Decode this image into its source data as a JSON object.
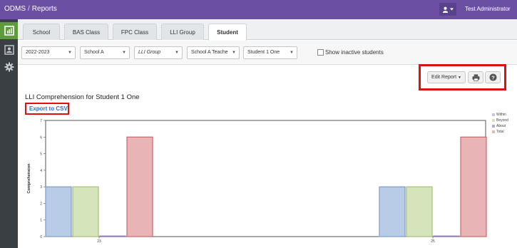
{
  "topbar": {
    "app": "ODMS",
    "separator": "/",
    "section": "Reports",
    "user_name": "Test Administrator",
    "user_icon": "user-icon"
  },
  "sidebar": {
    "items": [
      {
        "name": "reports-icon",
        "active": true
      },
      {
        "name": "student-card-icon",
        "active": false
      },
      {
        "name": "gear-icon",
        "active": false
      }
    ]
  },
  "tabs": [
    {
      "label": "School"
    },
    {
      "label": "BAS Class"
    },
    {
      "label": "FPC Class"
    },
    {
      "label": "LLI Group"
    },
    {
      "label": "Student",
      "active": true
    }
  ],
  "filters": {
    "year": "2022-2023",
    "school": "School A",
    "group": "LLI Group",
    "teacher": "School A Teache",
    "student": "Student 1 One",
    "show_inactive_label": "Show inactive students",
    "show_inactive_checked": false
  },
  "toolbar": {
    "edit_report": "Edit Report",
    "print_icon": "print-icon",
    "help_icon": "help-icon"
  },
  "report": {
    "title": "LLI Comprehension for Student 1 One",
    "export_label": "Export to CSV"
  },
  "chart_data": {
    "type": "bar",
    "categories": [
      "23",
      "25"
    ],
    "series": [
      {
        "name": "Within",
        "color": "#b8cce8",
        "values": [
          3,
          3
        ]
      },
      {
        "name": "Beyond",
        "color": "#d6e4bc",
        "values": [
          3,
          3
        ]
      },
      {
        "name": "About",
        "color": "#b7a6d3",
        "values": [
          0,
          0
        ]
      },
      {
        "name": "Total",
        "color": "#e8b4b6",
        "values": [
          6,
          6
        ]
      }
    ],
    "ylabel": "Comprehension",
    "ylim": [
      0,
      7
    ],
    "yticks": [
      "0",
      "1",
      "2",
      "3",
      "4",
      "5",
      "6",
      "7"
    ],
    "legend": "right"
  }
}
